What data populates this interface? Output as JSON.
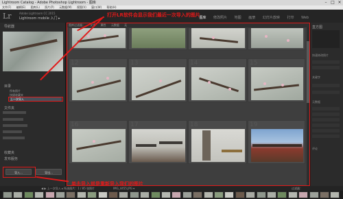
{
  "window": {
    "title": "Lightroom Catalog - Adobe Photoshop Lightroom - 图库",
    "minimize": "–",
    "maximize": "□",
    "close": "×"
  },
  "menubar": [
    "文件(F)",
    "编辑(E)",
    "图库(L)",
    "照片(P)",
    "元数据(M)",
    "视图(V)",
    "窗口(W)",
    "帮助(H)"
  ],
  "identity": {
    "logo": "Lr",
    "user": "Adobe Lightroom CC 2015",
    "app": "Lightroom mobile 入门 ▸"
  },
  "modules": [
    "图库",
    "修改照片",
    "地图",
    "画册",
    "幻灯片放映",
    "打印",
    "Web"
  ],
  "left_panel": {
    "navigator_title": "导航器",
    "catalog_title": "目录",
    "catalog_items": [
      {
        "label": "所有照片",
        "count": ""
      },
      {
        "label": "快捷收藏夹",
        "count": ""
      },
      {
        "label": "上一次导入",
        "count": ""
      }
    ],
    "folders_title": "文件夹",
    "collections_title": "收藏夹",
    "publish_title": "发布服务",
    "import_button": "导入...",
    "export_button": "导出..."
  },
  "right_panel": {
    "title": "直方图",
    "labels": [
      "快速修改照片",
      "关键字",
      "元数据",
      "评论"
    ]
  },
  "grid": {
    "tabs": [
      "图库过滤器：",
      "文本",
      "属性",
      "元数据",
      "无"
    ],
    "cell_numbers": [
      "8",
      "9",
      "10",
      "11",
      "12",
      "13",
      "14",
      "15",
      "16",
      "17",
      "18",
      "19"
    ]
  },
  "annotations": {
    "top": "打开LR软件会显示我们最近一次导入的图片",
    "bottom": "单击导入就是重新导入我们的图片"
  },
  "toolbar": {
    "left": "◀ ▶  上一次导入  ▸  所选图片：1 / 85 张照片",
    "filename": "IMG_4455.JPG ▾",
    "filter": "过滤器："
  },
  "colors": {
    "annotation": "#e11a1a",
    "panel": "#2b2b2b",
    "grid_bg": "#3e3e3e"
  }
}
